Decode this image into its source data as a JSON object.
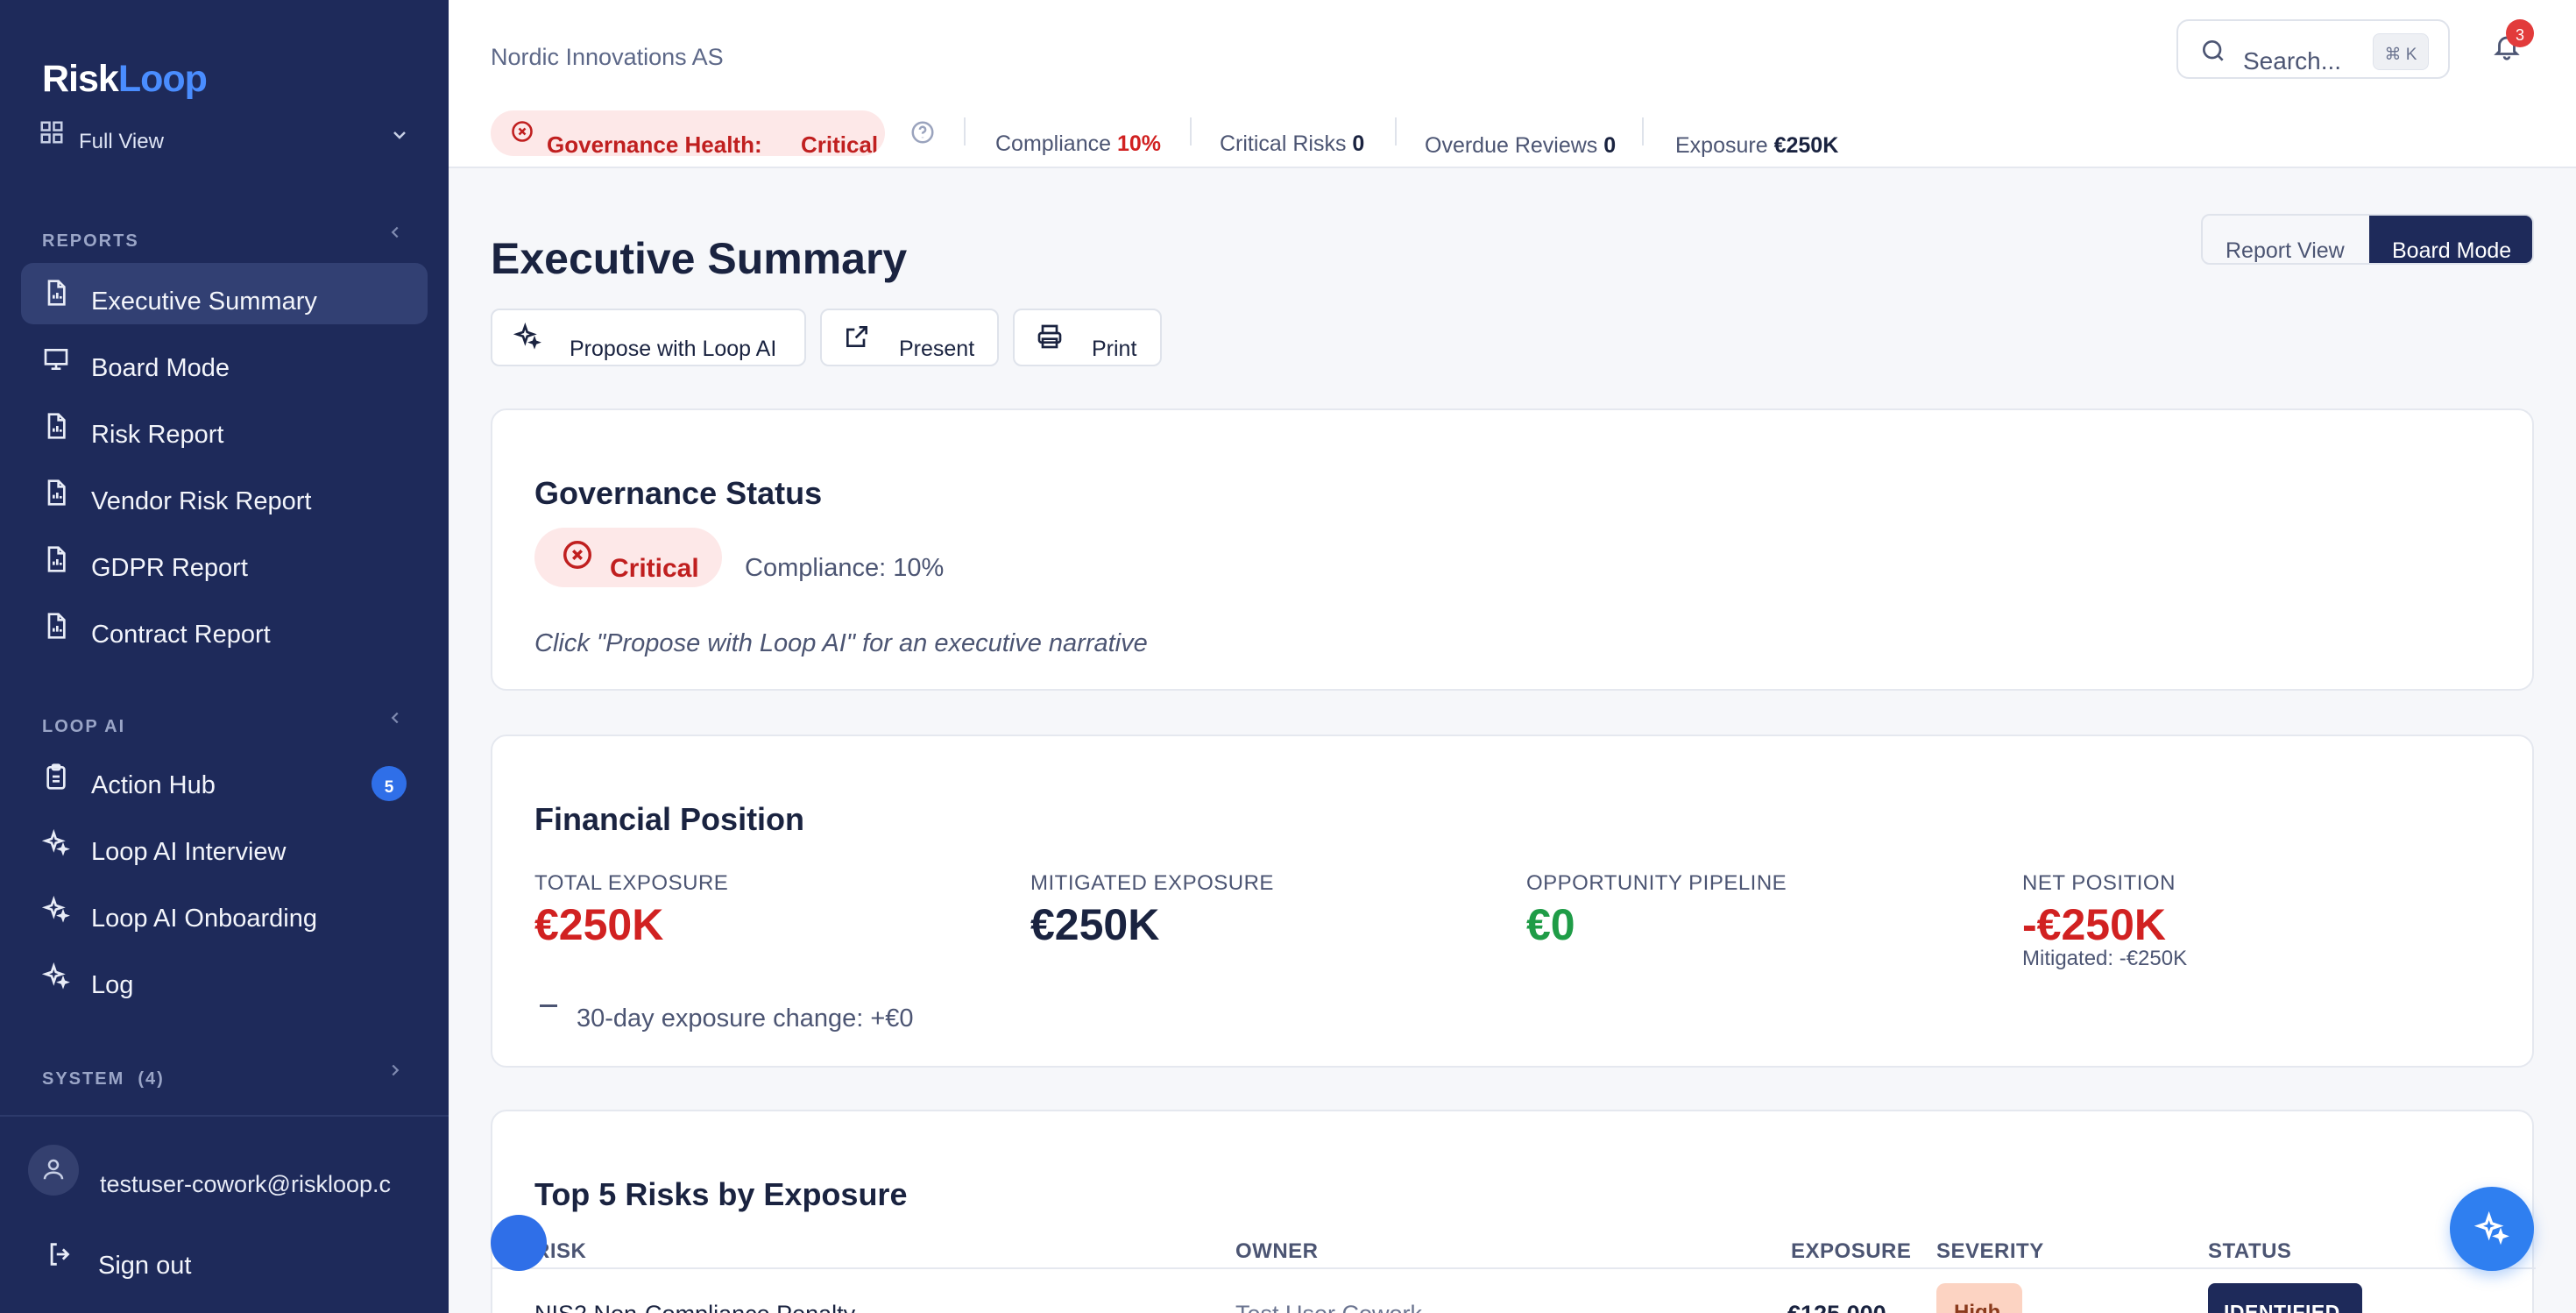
{
  "app": {
    "logo_part1": "Risk",
    "logo_part2": "Loop",
    "brand_color": "#4a8dff",
    "sidebar_color": "#1e2a5a"
  },
  "sidebar": {
    "view_selector": "Full View",
    "reports_header": "REPORTS",
    "reports": [
      {
        "label": "Executive Summary",
        "icon": "report-doc-icon",
        "active": true
      },
      {
        "label": "Board Mode",
        "icon": "presentation-icon"
      },
      {
        "label": "Risk Report",
        "icon": "report-doc-icon"
      },
      {
        "label": "Vendor Risk Report",
        "icon": "report-doc-icon"
      },
      {
        "label": "GDPR Report",
        "icon": "report-doc-icon"
      },
      {
        "label": "Contract Report",
        "icon": "report-doc-icon"
      }
    ],
    "loopai_header": "LOOP AI",
    "loopai": [
      {
        "label": "Action Hub",
        "icon": "clipboard-icon",
        "badge": "5"
      },
      {
        "label": "Loop AI Interview",
        "icon": "sparkles-icon"
      },
      {
        "label": "Loop AI Onboarding",
        "icon": "sparkles-icon"
      },
      {
        "label": "Log",
        "icon": "sparkles-icon"
      }
    ],
    "system_header": "SYSTEM",
    "system_count": "(4)",
    "user_email": "testuser-cowork@riskloop.c",
    "sign_out": "Sign out"
  },
  "topbar": {
    "company": "Nordic Innovations AS",
    "search_placeholder": "Search...",
    "search_shortcut": "⌘ K",
    "notification_count": "3",
    "health_label": "Governance Health:",
    "health_value": "Critical",
    "compliance_label": "Compliance",
    "compliance_value": "10%",
    "critical_label": "Critical Risks",
    "critical_value": "0",
    "overdue_label": "Overdue Reviews",
    "overdue_value": "0",
    "exposure_label": "Exposure",
    "exposure_value": "€250K"
  },
  "page": {
    "title": "Executive Summary",
    "view_toggle": {
      "report": "Report View",
      "board": "Board Mode",
      "selected": "Board Mode"
    },
    "actions": {
      "propose": "Propose with Loop AI",
      "present": "Present",
      "print": "Print"
    }
  },
  "governance": {
    "title": "Governance Status",
    "status": "Critical",
    "compliance": "Compliance: 10%",
    "narrative": "Click \"Propose with Loop AI\" for an executive narrative"
  },
  "financial": {
    "title": "Financial Position",
    "total_label": "TOTAL EXPOSURE",
    "total_value": "€250K",
    "mitigated_label": "MITIGATED EXPOSURE",
    "mitigated_value": "€250K",
    "pipeline_label": "OPPORTUNITY PIPELINE",
    "pipeline_value": "€0",
    "net_label": "NET POSITION",
    "net_value": "-€250K",
    "net_sub": "Mitigated: -€250K",
    "change_text": "30-day exposure change: +€0"
  },
  "top_risks": {
    "title": "Top 5 Risks by Exposure",
    "columns": {
      "risk": "RISK",
      "owner": "OWNER",
      "exposure": "EXPOSURE",
      "severity": "SEVERITY",
      "status": "STATUS"
    },
    "rows": [
      {
        "risk": "NIS2 Non-Compliance Penalty",
        "owner": "Test User Cowork",
        "exposure": "€125,000",
        "severity": "High",
        "status": "IDENTIFIED"
      }
    ]
  }
}
